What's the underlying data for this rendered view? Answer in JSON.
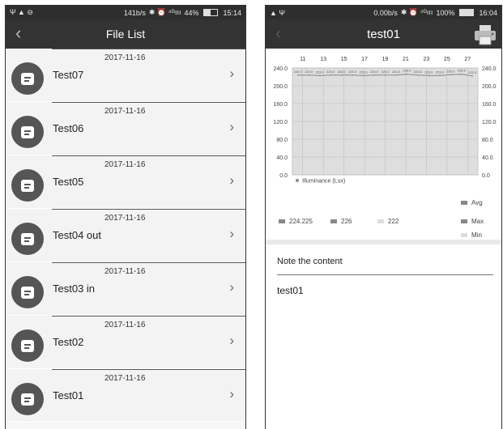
{
  "left": {
    "status": {
      "left_icons": "Ψ ▲ ⊖",
      "speed": "141b/s",
      "signal": "✱ ⏰ ⁴ᴳııı",
      "battery": "44%",
      "time": "15:14",
      "battery_level": 0.44
    },
    "title": "File List",
    "back_icon": "‹",
    "items": [
      {
        "date": "2017-11-16",
        "name": "Test07"
      },
      {
        "date": "2017-11-16",
        "name": "Test06"
      },
      {
        "date": "2017-11-16",
        "name": "Test05"
      },
      {
        "date": "2017-11-16",
        "name": "Test04 out"
      },
      {
        "date": "2017-11-16",
        "name": "Test03 in"
      },
      {
        "date": "2017-11-16",
        "name": "Test02"
      },
      {
        "date": "2017-11-16",
        "name": "Test01"
      }
    ]
  },
  "right": {
    "status": {
      "left_icons": "▲ Ψ",
      "speed": "0.00b/s",
      "signal": "✱ ⏰ ⁴ᴳııı",
      "battery": "100%",
      "time": "16:04",
      "battery_level": 1.0
    },
    "title": "test01",
    "back_icon": "‹",
    "note_label": "Note the content",
    "note_value": "test01",
    "summary": [
      {
        "label": "224.225",
        "color": "#888888"
      },
      {
        "label": "226",
        "color": "#888888"
      },
      {
        "label": "222",
        "color": "#dddddd"
      }
    ],
    "stat_legend": [
      {
        "label": "Avg",
        "color": "#888888"
      },
      {
        "label": "Max",
        "color": "#888888"
      },
      {
        "label": "Min",
        "color": "#dddddd"
      }
    ]
  },
  "chart_data": {
    "type": "line",
    "x_ticks": [
      "11",
      "13",
      "15",
      "17",
      "19",
      "21",
      "23",
      "25",
      "27"
    ],
    "y_ticks": [
      "240.0",
      "200.0",
      "160.0",
      "120.0",
      "80.0",
      "40.0",
      "0.0"
    ],
    "ylim": [
      0,
      240
    ],
    "grid": true,
    "legend": "bottom-left",
    "series": [
      {
        "name": "Illuminance (Lux)",
        "color": "#888888",
        "values": [
          224.0,
          224.0,
          223.0,
          224.0,
          224.0,
          224.0,
          223.0,
          224.0,
          224.0,
          224.0,
          226.0,
          224.0,
          223.0,
          223.0,
          225.0,
          226.0,
          222.0
        ],
        "labels": [
          "224.0",
          "224.0",
          "223.0",
          "224.0",
          "224.0",
          "224.0",
          "223.0",
          "224.0",
          "224.0",
          "224.0",
          "226.0",
          "224.0",
          "223.0",
          "223.0",
          "225.0",
          "226.0",
          "222.0"
        ]
      }
    ]
  }
}
